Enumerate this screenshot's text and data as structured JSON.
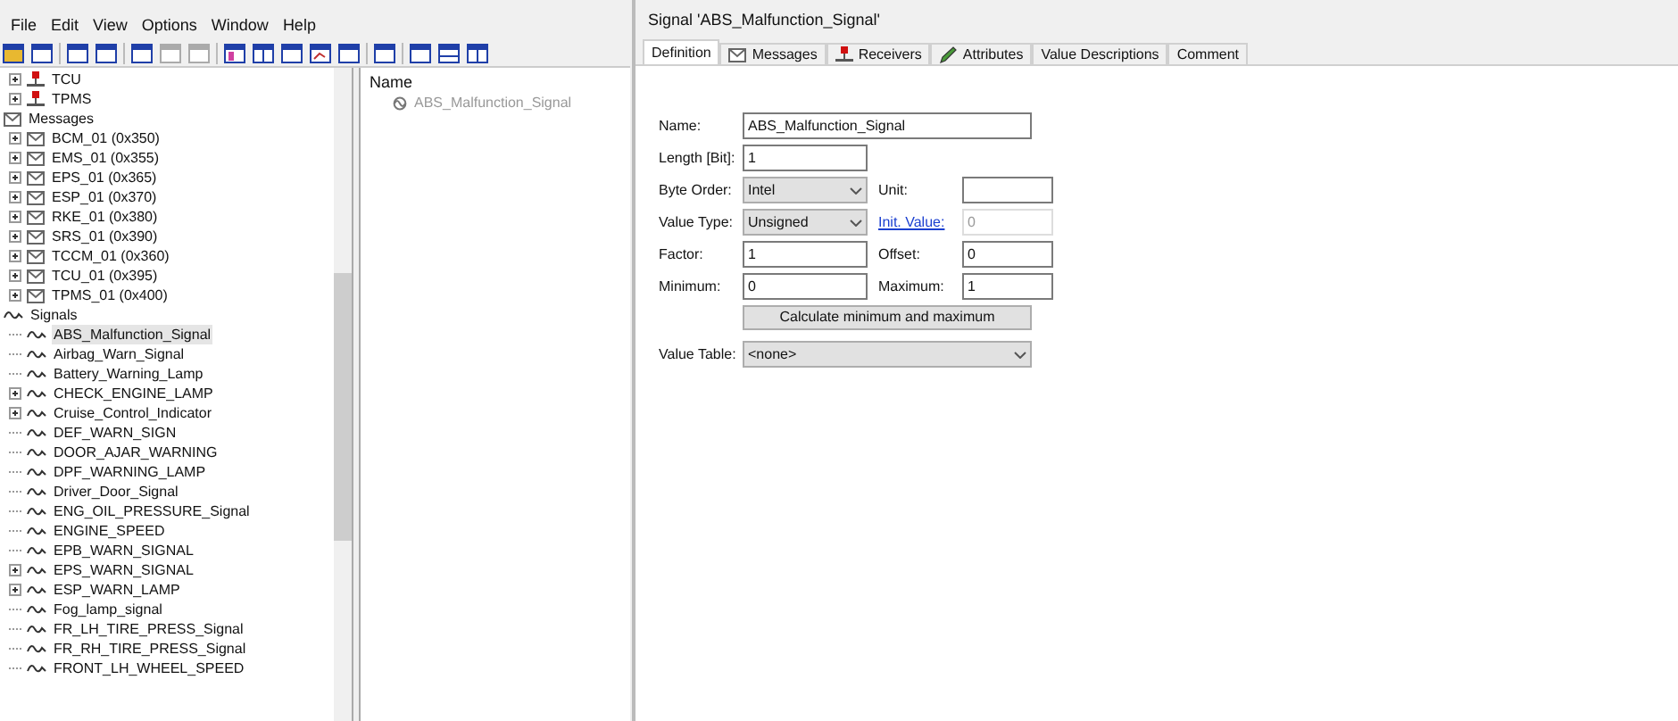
{
  "menu": [
    "File",
    "Edit",
    "View",
    "Options",
    "Window",
    "Help"
  ],
  "nodes": [
    {
      "label": "TCU",
      "expandable": true,
      "selected": false
    },
    {
      "label": "TPMS",
      "expandable": true,
      "selected": false
    }
  ],
  "tree": [
    {
      "label": "Messages",
      "kind": "message",
      "selected": false,
      "children": [
        {
          "label": "BCM_01 (0x350)",
          "expandable": true,
          "selected": false
        },
        {
          "label": "EMS_01 (0x355)",
          "expandable": true,
          "selected": false
        },
        {
          "label": "EPS_01 (0x365)",
          "expandable": true,
          "selected": false
        },
        {
          "label": "ESP_01 (0x370)",
          "expandable": true,
          "selected": false
        },
        {
          "label": "RKE_01 (0x380)",
          "expandable": true,
          "selected": false
        },
        {
          "label": "SRS_01 (0x390)",
          "expandable": true,
          "selected": false
        },
        {
          "label": "TCCM_01 (0x360)",
          "expandable": true,
          "selected": false
        },
        {
          "label": "TCU_01 (0x395)",
          "expandable": true,
          "selected": false
        },
        {
          "label": "TPMS_01 (0x400)",
          "expandable": true,
          "selected": false
        }
      ]
    },
    {
      "label": "Signals",
      "kind": "signal",
      "selected": false,
      "children": [
        {
          "label": "ABS_Malfunction_Signal",
          "expandable": false,
          "selected": true
        },
        {
          "label": "Airbag_Warn_Signal",
          "expandable": false,
          "selected": false
        },
        {
          "label": "Battery_Warning_Lamp",
          "expandable": false,
          "selected": false
        },
        {
          "label": "CHECK_ENGINE_LAMP",
          "expandable": true,
          "selected": false
        },
        {
          "label": "Cruise_Control_Indicator",
          "expandable": true,
          "selected": false
        },
        {
          "label": "DEF_WARN_SIGN",
          "expandable": false,
          "selected": false
        },
        {
          "label": "DOOR_AJAR_WARNING",
          "expandable": false,
          "selected": false
        },
        {
          "label": "DPF_WARNING_LAMP",
          "expandable": false,
          "selected": false
        },
        {
          "label": "Driver_Door_Signal",
          "expandable": false,
          "selected": false
        },
        {
          "label": "ENG_OIL_PRESSURE_Signal",
          "expandable": false,
          "selected": false
        },
        {
          "label": "ENGINE_SPEED",
          "expandable": false,
          "selected": false
        },
        {
          "label": "EPB_WARN_SIGNAL",
          "expandable": false,
          "selected": false
        },
        {
          "label": "EPS_WARN_SIGNAL",
          "expandable": true,
          "selected": false
        },
        {
          "label": "ESP_WARN_LAMP",
          "expandable": true,
          "selected": false
        },
        {
          "label": "Fog_lamp_signal",
          "expandable": false,
          "selected": false
        },
        {
          "label": "FR_LH_TIRE_PRESS_Signal",
          "expandable": false,
          "selected": false
        },
        {
          "label": "FR_RH_TIRE_PRESS_Signal",
          "expandable": false,
          "selected": false
        },
        {
          "label": "FRONT_LH_WHEEL_SPEED",
          "expandable": false,
          "selected": false
        }
      ]
    }
  ],
  "list": {
    "header": "Name",
    "items": [
      "ABS_Malfunction_Signal"
    ]
  },
  "dialog": {
    "title": "Signal 'ABS_Malfunction_Signal'",
    "tabs": [
      {
        "label": "Definition",
        "kind": "plain",
        "selected": true
      },
      {
        "label": "Messages",
        "kind": "message",
        "selected": false
      },
      {
        "label": "Receivers",
        "kind": "node",
        "selected": false
      },
      {
        "label": "Attributes",
        "kind": "edit",
        "selected": false
      },
      {
        "label": "Value Descriptions",
        "kind": "plain",
        "selected": false
      },
      {
        "label": "Comment",
        "kind": "plain",
        "selected": false
      }
    ],
    "name": {
      "label": "Name:",
      "value": "ABS_Malfunction_Signal"
    },
    "length": {
      "label": "Length [Bit]:",
      "value": "1"
    },
    "byte_order": {
      "label": "Byte Order:",
      "value": "Intel"
    },
    "unit": {
      "label": "Unit:"
    },
    "value_type": {
      "label": "Value Type:",
      "value": "Unsigned"
    },
    "init_value": {
      "label": "Init. Value:",
      "value": "0",
      "disabled": true
    },
    "factor": {
      "label": "Factor:",
      "value": "1"
    },
    "offset": {
      "label": "Offset:",
      "value": "0"
    },
    "minimum": {
      "label": "Minimum:",
      "value": "0"
    },
    "maximum": {
      "label": "Maximum:",
      "value": "1"
    },
    "calculate_button": "Calculate minimum and maximum",
    "value_table": {
      "label": "Value Table:",
      "value": "<none>"
    }
  }
}
